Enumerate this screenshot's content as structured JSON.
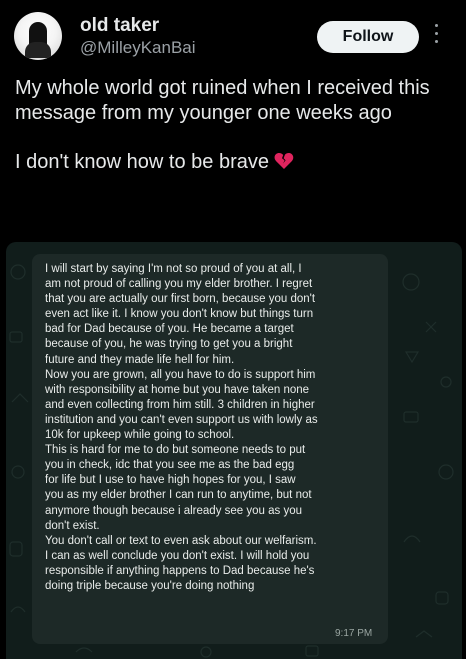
{
  "profile": {
    "display_name": "old taker",
    "handle": "@MilleyKanBai",
    "follow_label": "Follow"
  },
  "post": {
    "line1": "My whole world got ruined when I received this message from my younger one weeks ago",
    "line2": "I don't know how to be brave",
    "emoji": "broken-heart-icon"
  },
  "screenshot": {
    "message": "I will start by saying I'm not so proud of you at all, I\nam not proud of calling you my elder brother. I regret\nthat you are actually our first born, because you don't\neven act like it. I know you don't know but things turn\nbad for Dad because of you. He became a target\nbecause of you, he was trying to get you a bright\nfuture and they made life hell for him.\nNow you are grown, all you have to do is support him\nwith responsibility at home but you have taken none\nand even collecting from him still. 3 children in higher\ninstitution and you can't even support us with lowly as\n10k for upkeep while going to school.\nThis is hard for me to do but someone needs to put\nyou in check, idc that you see me as the bad egg\nfor life but I use to have high hopes for you, I saw\nyou as my elder brother I can run to anytime, but not\nanymore though because i already see you as you\ndon't exist.\nYou don't call or text to even ask about our welfarism.\nI can as well conclude you don't exist. I will hold you\nresponsible if anything happens to Dad because he's\ndoing triple because you're doing nothing",
    "time": "9:17 PM"
  },
  "colors": {
    "background": "#000000",
    "chat_background": "#111d1b",
    "bubble": "#1d2927",
    "broken_heart": "#e0245e"
  }
}
